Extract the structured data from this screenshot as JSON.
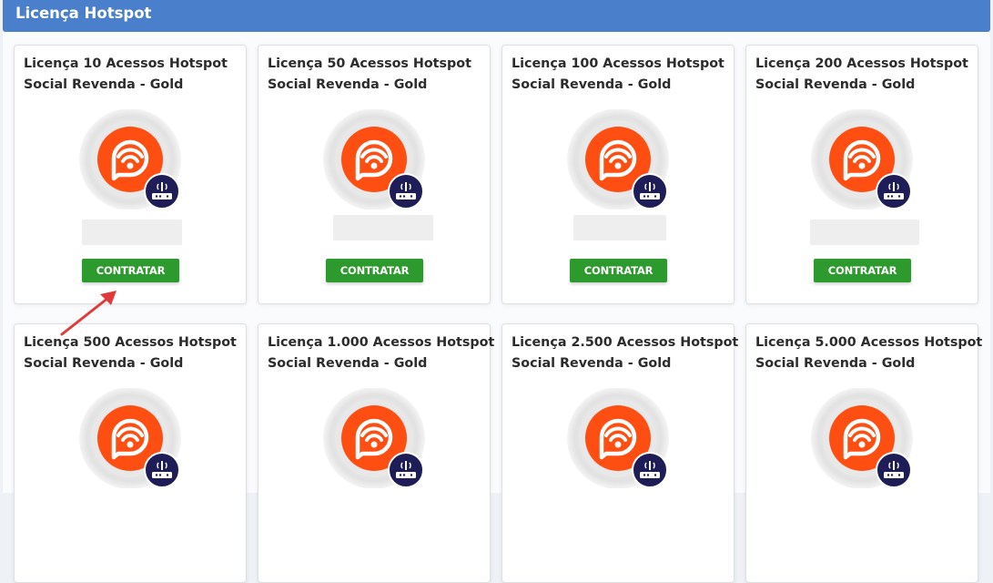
{
  "header": {
    "title": "Licença Hotspot"
  },
  "colors": {
    "header": "#4a7fcb",
    "button": "#2c9a2c",
    "logo": "#fe4e12",
    "badge": "#1e1d57",
    "arrow": "#e03b3b"
  },
  "cards": [
    {
      "title_line1": "Licença 10 Acessos Hotspot",
      "title_line2": "Social Revenda - Gold",
      "button": "CONTRATAR"
    },
    {
      "title_line1": "Licença 50 Acessos Hotspot",
      "title_line2": "Social Revenda - Gold",
      "button": "CONTRATAR"
    },
    {
      "title_line1": "Licença 100 Acessos Hotspot",
      "title_line2": "Social Revenda - Gold",
      "button": "CONTRATAR"
    },
    {
      "title_line1": "Licença 200 Acessos Hotspot",
      "title_line2": "Social Revenda - Gold",
      "button": "CONTRATAR"
    },
    {
      "title_line1": "Licença 500 Acessos Hotspot",
      "title_line2": "Social Revenda - Gold"
    },
    {
      "title_line1": "Licença 1.000 Acessos Hotspot",
      "title_line2": "Social Revenda - Gold"
    },
    {
      "title_line1": "Licença 2.500 Acessos Hotspot",
      "title_line2": "Social Revenda - Gold"
    },
    {
      "title_line1": "Licença 5.000 Acessos Hotspot",
      "title_line2": "Social Revenda - Gold"
    }
  ]
}
